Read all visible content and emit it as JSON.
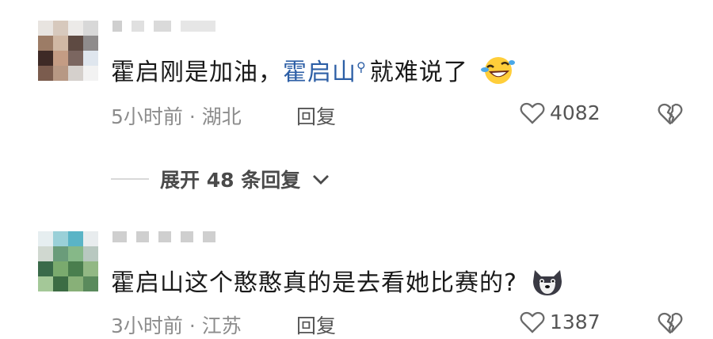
{
  "comments": [
    {
      "text_prefix": "霍启刚是加油，",
      "link_text": "霍启山",
      "text_suffix": "就难说了",
      "emoji": "laughing-tears-emoji",
      "time": "5小时前",
      "location": "湖北",
      "reply_label": "回复",
      "likes": "4082"
    },
    {
      "text": "霍启山这个憨憨真的是去看她比赛的?",
      "emoji": "doge-emoji",
      "time": "3小时前",
      "location": "江苏",
      "reply_label": "回复",
      "likes": "1387"
    }
  ],
  "expand_replies": "展开 48 条回复",
  "meta_separator": "·",
  "colors": {
    "link": "#2d5fa6",
    "meta": "#8c8c8c",
    "text": "#1a1a1a"
  }
}
